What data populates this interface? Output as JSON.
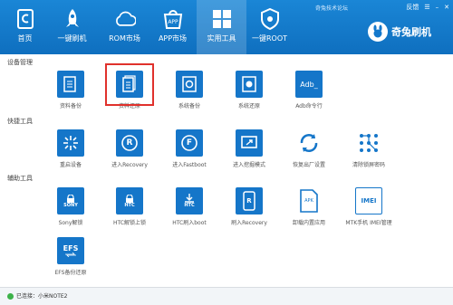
{
  "nav": [
    {
      "label": "首页",
      "icon": "home-icon"
    },
    {
      "label": "一键刷机",
      "icon": "rocket-icon"
    },
    {
      "label": "ROM市场",
      "icon": "cloud-icon"
    },
    {
      "label": "APP市场",
      "icon": "app-store-icon"
    },
    {
      "label": "实用工具",
      "icon": "grid-icon",
      "active": true
    },
    {
      "label": "一键ROOT",
      "icon": "shield-icon"
    }
  ],
  "brand": {
    "forum": "奇兔技术论坛",
    "feedback": "反馈",
    "name": "奇兔刷机"
  },
  "sections": {
    "device": {
      "title": "设备管理",
      "items": [
        {
          "label": "资料备份",
          "icon": "document-backup-icon"
        },
        {
          "label": "资料还原",
          "icon": "document-restore-icon"
        },
        {
          "label": "系统备份",
          "icon": "system-backup-icon"
        },
        {
          "label": "系统还原",
          "icon": "system-restore-icon"
        },
        {
          "label": "Adb命令行",
          "icon": "adb-terminal-icon",
          "glyph": "Adb_"
        }
      ]
    },
    "shortcuts": {
      "title": "快捷工具",
      "items": [
        {
          "label": "重启设备",
          "icon": "restart-icon"
        },
        {
          "label": "进入Recovery",
          "icon": "recovery-icon",
          "glyph": "R"
        },
        {
          "label": "进入Fastboot",
          "icon": "fastboot-icon",
          "glyph": "F"
        },
        {
          "label": "进入挖掘模式",
          "icon": "mode-icon"
        },
        {
          "label": "恢复出厂设置",
          "icon": "factory-reset-icon"
        },
        {
          "label": "清除锁屏密码",
          "icon": "pattern-lock-icon"
        }
      ]
    },
    "aux": {
      "title": "辅助工具",
      "items": [
        {
          "label": "Sony解锁",
          "icon": "sony-unlock-icon",
          "glyph": "SONY"
        },
        {
          "label": "HTC解锁上锁",
          "icon": "htc-unlock-icon",
          "glyph": "HTC"
        },
        {
          "label": "HTC刷入boot",
          "icon": "htc-boot-icon",
          "glyph": "HTC"
        },
        {
          "label": "刷入Recovery",
          "icon": "flash-recovery-icon",
          "glyph": "R"
        },
        {
          "label": "卸载内置应用",
          "icon": "uninstall-app-icon",
          "glyph": "APK"
        },
        {
          "label": "MTK手机 IMEI管理",
          "icon": "imei-icon",
          "glyph": "IMEI"
        },
        {
          "label": "EFS备份还原",
          "icon": "efs-icon",
          "glyph": "EFS"
        }
      ]
    }
  },
  "status": {
    "text": "已连接：小米NOTE2"
  },
  "colors": {
    "topbar": "#1378cc",
    "tile": "#1576c9",
    "highlight": "#e0312c"
  }
}
